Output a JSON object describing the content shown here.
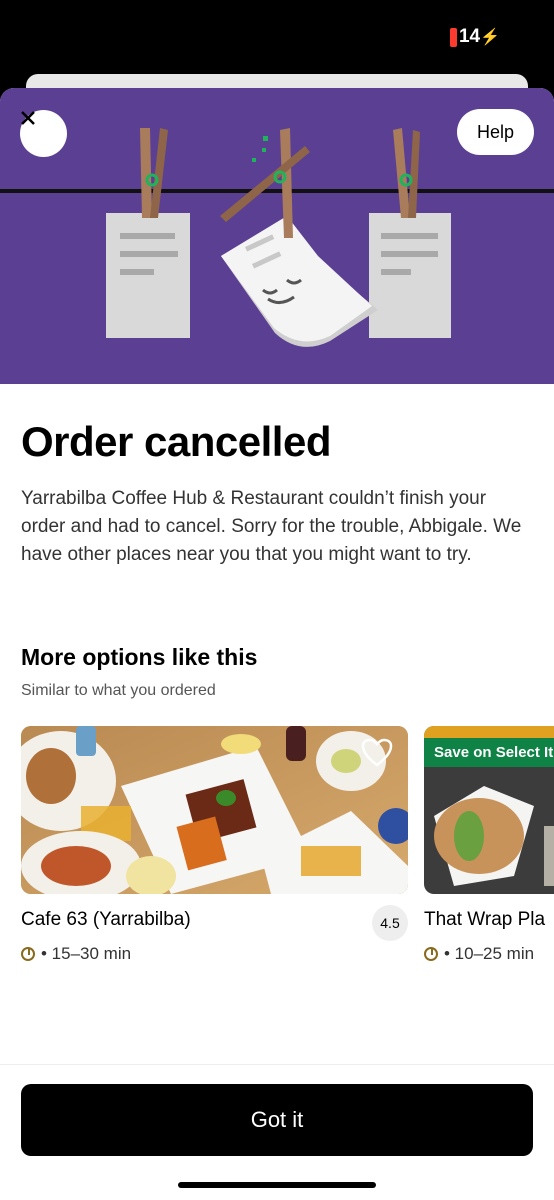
{
  "status_bar": {
    "battery": "14"
  },
  "header": {
    "help_label": "Help",
    "close_icon": "close-icon"
  },
  "hero": {
    "icon": "cancelled-receipt-illustration",
    "bg_color": "#5b3f93"
  },
  "main": {
    "title": "Order cancelled",
    "description": "Yarrabilba Coffee Hub & Restaurant couldn’t finish your order and had to cancel. Sorry for the trouble, Abbigale. We have other places near you that you might want to try."
  },
  "options": {
    "title": "More options like this",
    "subtitle": "Similar to what you ordered",
    "cards": [
      {
        "name": "Cafe 63 (Yarrabilba)",
        "rating": "4.5",
        "eta": "• 15–30 min",
        "promo": ""
      },
      {
        "name": "That Wrap Pla",
        "rating": "",
        "eta": "• 10–25 min",
        "promo": "Save on Select It"
      }
    ]
  },
  "footer": {
    "button_label": "Got it"
  }
}
